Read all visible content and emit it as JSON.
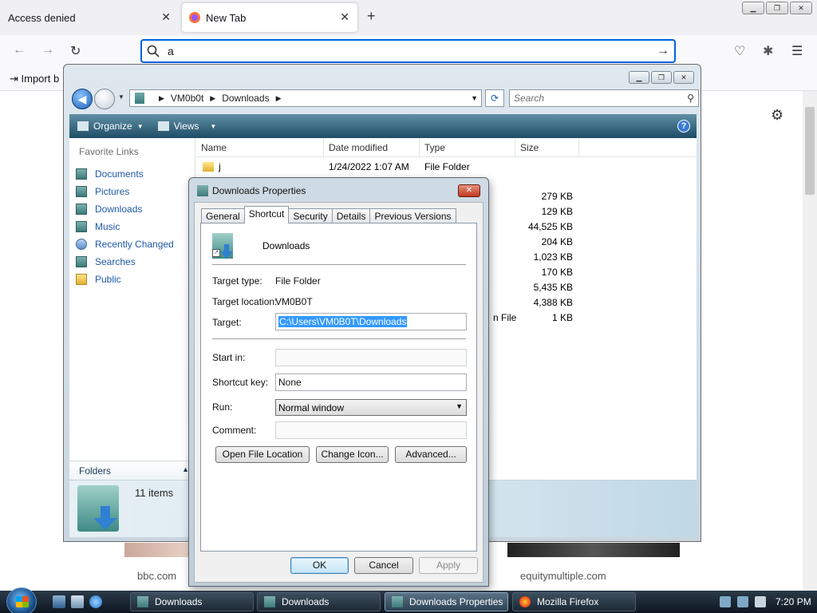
{
  "browser": {
    "tabs": [
      {
        "title": "Access denied",
        "active": false
      },
      {
        "title": "New Tab",
        "active": true
      }
    ],
    "url_value": "a",
    "bookmarks_import": "Import b",
    "tiles": [
      {
        "label": "bbc.com"
      },
      {
        "label": "equitymultiple.com"
      }
    ]
  },
  "explorer": {
    "breadcrumb": [
      "VM0b0t",
      "Downloads"
    ],
    "search_placeholder": "Search",
    "toolbar": {
      "organize": "Organize",
      "views": "Views"
    },
    "favorite_links_title": "Favorite Links",
    "favorite_links": [
      {
        "label": "Documents",
        "icon": "documents-icon"
      },
      {
        "label": "Pictures",
        "icon": "pictures-icon"
      },
      {
        "label": "Downloads",
        "icon": "downloads-icon"
      },
      {
        "label": "Music",
        "icon": "music-icon"
      },
      {
        "label": "Recently Changed",
        "icon": "recent-icon"
      },
      {
        "label": "Searches",
        "icon": "searches-icon"
      },
      {
        "label": "Public",
        "icon": "public-folder-icon"
      }
    ],
    "folders_label": "Folders",
    "columns": [
      "Name",
      "Date modified",
      "Type",
      "Size"
    ],
    "first_row": {
      "name": "j",
      "date": "1/24/2022 1:07 AM",
      "type": "File Folder"
    },
    "sizes": [
      "279 KB",
      "129 KB",
      "44,525 KB",
      "204 KB",
      "1,023 KB",
      "170 KB",
      "5,435 KB",
      "4,388 KB",
      "1 KB"
    ],
    "partial_type_last": "n File",
    "item_count": "11 items"
  },
  "dialog": {
    "title": "Downloads Properties",
    "tabs": [
      "General",
      "Shortcut",
      "Security",
      "Details",
      "Previous Versions"
    ],
    "selected_tab": "Shortcut",
    "shortcut_name": "Downloads",
    "target_type_label": "Target type:",
    "target_type_value": "File Folder",
    "target_location_label": "Target location:",
    "target_location_value": "VM0B0T",
    "target_label": "Target:",
    "target_value": "C:\\Users\\VM0B0T\\Downloads",
    "start_in_label": "Start in:",
    "start_in_value": "",
    "shortcut_key_label": "Shortcut key:",
    "shortcut_key_value": "None",
    "run_label": "Run:",
    "run_value": "Normal window",
    "comment_label": "Comment:",
    "comment_value": "",
    "buttons": {
      "open_file_location": "Open File Location",
      "change_icon": "Change Icon...",
      "advanced": "Advanced...",
      "ok": "OK",
      "cancel": "Cancel",
      "apply": "Apply"
    }
  },
  "taskbar": {
    "buttons": [
      {
        "label": "Downloads",
        "active": false
      },
      {
        "label": "Downloads",
        "active": false
      },
      {
        "label": "Downloads Properties",
        "active": true
      },
      {
        "label": "Mozilla Firefox",
        "active": false
      }
    ],
    "clock": "7:20 PM"
  }
}
